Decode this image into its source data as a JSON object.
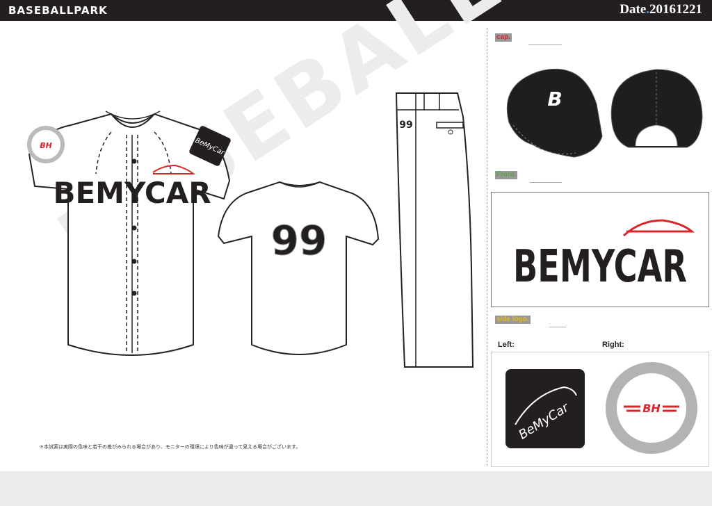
{
  "header": {
    "brand": "BASEBALLPARK",
    "date_prefix": "Date",
    "date_dot": ".",
    "date_value": "20161221"
  },
  "watermark": "BASEBALLPARK",
  "front_jersey": {
    "wordmark": "BEMYCAR",
    "sleeve_patch_text": "BeMyCar",
    "sleeve_logo_text": "BH"
  },
  "back_jersey": {
    "number": "99"
  },
  "pants": {
    "number": "99"
  },
  "sections": {
    "cap": {
      "label": "cap.",
      "cap_letter": "B"
    },
    "front": {
      "label": "Front.",
      "wordmark": "BEMYCAR"
    },
    "side_logo": {
      "label": "side logo.",
      "left_label": "Left:",
      "right_label": "Right:",
      "left_logo_text": "BeMyCar",
      "right_logo_text": "BH"
    }
  },
  "note": "※本試案は実際の色味と若干の差がみられる場合があり、モニターの環境により色味が違って見える場合がございます。",
  "colors": {
    "header_bg": "#231f20",
    "logo_red": "#d9262a",
    "cap_black": "#1f1d1e",
    "grey_number": "#9b9b9b",
    "ring_grey": "#b3b3b3"
  }
}
